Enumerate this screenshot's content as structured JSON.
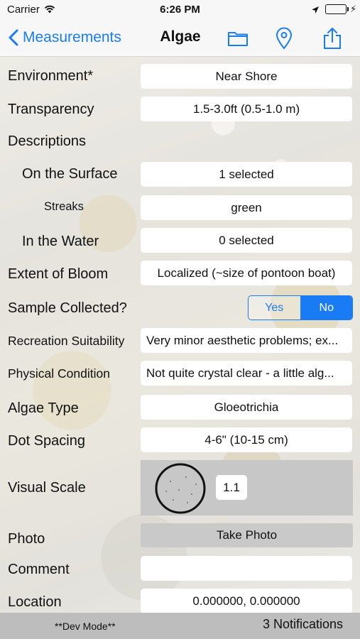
{
  "status_bar": {
    "carrier": "Carrier",
    "time": "6:26 PM",
    "icons": [
      "wifi-icon",
      "location-arrow-icon",
      "battery-icon",
      "charging-bolt-icon"
    ],
    "battery_color": "#4cd964"
  },
  "nav": {
    "back_label": "Measurements",
    "title": "Algae",
    "icons": [
      "folder-icon",
      "map-pin-icon",
      "share-icon"
    ],
    "accent_color": "#1a7cf5"
  },
  "form": {
    "environment": {
      "label": "Environment*",
      "value": "Near Shore"
    },
    "transparency": {
      "label": "Transparency",
      "value": "1.5-3.0ft (0.5-1.0 m)"
    },
    "descriptions": {
      "label": "Descriptions"
    },
    "on_surface": {
      "label": "On the Surface",
      "value": "1 selected"
    },
    "streaks": {
      "label": "Streaks",
      "value": "green"
    },
    "in_water": {
      "label": "In the Water",
      "value": "0 selected"
    },
    "extent": {
      "label": "Extent of Bloom",
      "value": "Localized (~size of pontoon boat)"
    },
    "sample": {
      "label": "Sample Collected?",
      "options": [
        "Yes",
        "No"
      ],
      "selected": "No"
    },
    "recreation": {
      "label": "Recreation Suitability",
      "value": "Very minor aesthetic problems; ex..."
    },
    "physical": {
      "label": "Physical Condition",
      "value": "Not quite crystal clear - a little alg..."
    },
    "algae_type": {
      "label": "Algae Type",
      "value": "Gloeotrichia"
    },
    "dot_spacing": {
      "label": "Dot Spacing",
      "value": "4-6\" (10-15 cm)"
    },
    "visual_scale": {
      "label": "Visual Scale",
      "value": "1.1"
    },
    "photo": {
      "label": "Photo",
      "button": "Take Photo"
    },
    "comment": {
      "label": "Comment",
      "value": ""
    },
    "location": {
      "label": "Location",
      "value": "0.000000, 0.000000"
    }
  },
  "footer": {
    "dev_mode": "**Dev Mode**",
    "notifications": "3 Notifications"
  }
}
